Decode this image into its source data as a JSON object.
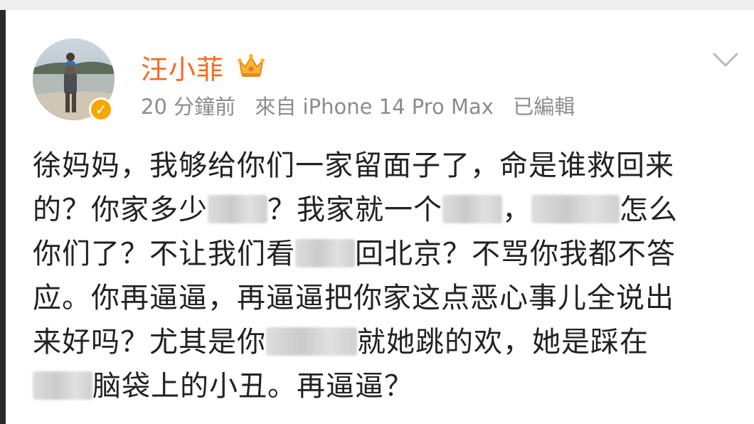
{
  "post": {
    "username": "汪小菲",
    "timestamp": "20 分鐘前",
    "source": "來自 iPhone 14 Pro Max",
    "edited": "已編輯",
    "content_lines": [
      [
        "徐妈妈，我够给你们一家留面子了，命是谁救回来"
      ],
      [
        "的？你家多少",
        "？我家就一个",
        "，",
        "怎么"
      ],
      [
        "你们了？不让我们看",
        "回北京？不骂你我都不答"
      ],
      [
        "应。你再逼逼，再逼逼把你家这点恶心事儿全说出"
      ],
      [
        "来好吗？尤其是你",
        "就她跳的欢，她是踩在"
      ],
      [
        "脑袋上的小丑。再逼逼？"
      ]
    ]
  },
  "icons": {
    "crown": "crown-icon",
    "verified": "verified-badge-icon",
    "menu": "chevron-down-icon"
  },
  "colors": {
    "username": "#f26c22",
    "meta": "#8c8c8c",
    "verified": "#f7a800",
    "text": "#222222"
  }
}
